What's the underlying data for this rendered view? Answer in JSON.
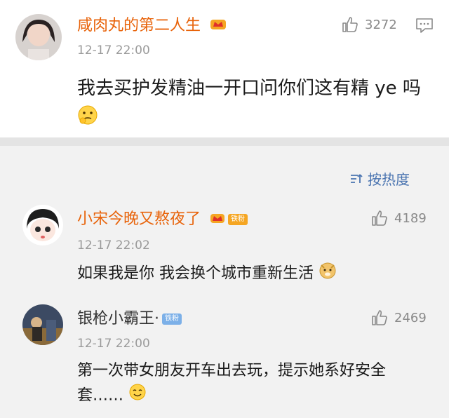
{
  "main_comment": {
    "username": "咸肉丸的第二人生",
    "time": "12-17 22:00",
    "text": "我去买护发精油一开口问你们这有精 ye 吗",
    "likes": "3272"
  },
  "sort": {
    "label": "按热度"
  },
  "replies": [
    {
      "username": "小宋今晚又熬夜了",
      "badge": "铁粉",
      "time": "12-17 22:02",
      "text": "如果我是你 我会换个城市重新生活",
      "likes": "4189"
    },
    {
      "username": "银枪小霸王·",
      "badge": "铁粉",
      "time": "12-17 22:00",
      "text": "第一次带女朋友开车出去玩，提示她系好安全套……",
      "likes": "2469"
    }
  ],
  "colors": {
    "username_orange": "#e8630a",
    "link_blue": "#4a74b0",
    "muted": "#9a9a9a"
  }
}
